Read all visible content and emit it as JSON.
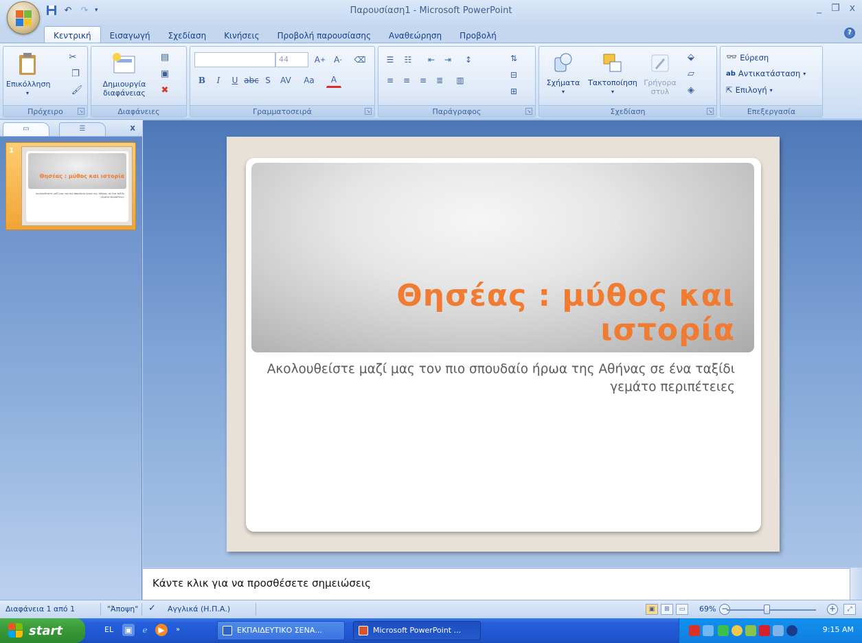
{
  "window": {
    "title": "Παρουσίαση1 - Microsoft PowerPoint",
    "minimize": "_",
    "restore": "❐",
    "close": "x"
  },
  "tabs": [
    "Κεντρική",
    "Εισαγωγή",
    "Σχεδίαση",
    "Κινήσεις",
    "Προβολή παρουσίασης",
    "Αναθεώρηση",
    "Προβολή"
  ],
  "ribbon": {
    "clipboard": {
      "label": "Πρόχειρο",
      "paste": "Επικόλληση"
    },
    "slides": {
      "label": "Διαφάνειες",
      "new_slide_1": "Δημιουργία",
      "new_slide_2": "διαφάνειας"
    },
    "font": {
      "label": "Γραμματοσειρά",
      "font_name": "",
      "font_size": "44"
    },
    "paragraph": {
      "label": "Παράγραφος"
    },
    "drawing": {
      "label": "Σχεδίαση",
      "shapes": "Σχήματα",
      "arrange": "Τακτοποίηση",
      "quick_styles_1": "Γρήγορα",
      "quick_styles_2": "στυλ"
    },
    "editing": {
      "label": "Επεξεργασία",
      "find": "Εύρεση",
      "replace": "Αντικατάσταση",
      "select": "Επιλογή"
    }
  },
  "left_pane": {
    "close": "x",
    "thumbnail_number": "1",
    "thumbnail_title": "Θησέας : μύθος και ιστορία",
    "thumbnail_subtitle": "Ακολουθείστε μαζί μας τον πιο σπουδαίο ήρωα της Αθήνας σε ένα ταξίδι γεμάτο περιπέτειες"
  },
  "slide": {
    "title": "Θησέας : μύθος και ιστορία",
    "subtitle": "Ακολουθείστε μαζί μας τον πιο σπουδαίο ήρωα της Αθήνας σε ένα ταξίδι γεμάτο περιπέτειες"
  },
  "notes": {
    "placeholder": "Κάντε κλικ για να προσθέσετε σημειώσεις"
  },
  "status": {
    "slide_counter": "Διαφάνεια 1 από 1",
    "theme": "\"Άποψη\"",
    "language": "Αγγλικά (Η.Π.Α.)",
    "zoom": "69%"
  },
  "taskbar": {
    "start": "start",
    "language": "EL",
    "task1": "ΕΚΠΑΙΔΕΥΤΙΚΟ ΣΕΝΑ...",
    "task2": "Microsoft PowerPoint ...",
    "clock": "9:15 AM"
  },
  "colors": {
    "title_orange": "#f07b33",
    "ribbon_blue": "#15428b",
    "taskbar_blue": "#245edb"
  }
}
